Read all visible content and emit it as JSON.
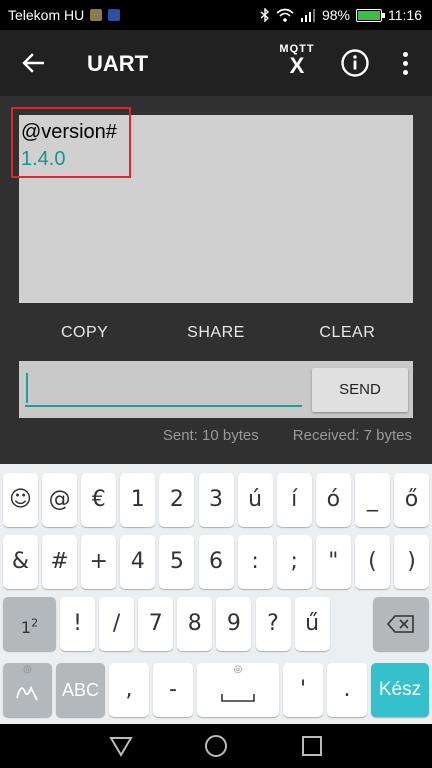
{
  "status_bar": {
    "carrier": "Telekom HU",
    "battery": "98%",
    "battery_level": 0.98,
    "time": "11:16",
    "icons": [
      "message-icon",
      "usb-icon",
      "bluetooth-icon",
      "wifi-icon",
      "signal-icon",
      "battery-charging-icon"
    ]
  },
  "app_bar": {
    "title": "UART",
    "mqtt_label": "MQTT",
    "mqtt_x": "X",
    "icons": [
      "back-arrow-icon",
      "mqtt-icon",
      "info-icon",
      "more-vert-icon"
    ]
  },
  "console": {
    "command": "@version#",
    "response": "1.4.0"
  },
  "actions": {
    "copy": "COPY",
    "share": "SHARE",
    "clear": "CLEAR"
  },
  "input": {
    "value": "",
    "send_label": "SEND"
  },
  "stats": {
    "sent": "Sent: 10 bytes",
    "received": "Received: 7 bytes"
  },
  "keyboard": {
    "row1": [
      "☺",
      "@",
      "€",
      "1",
      "2",
      "3",
      "ú",
      "í",
      "ó",
      "_",
      "ő"
    ],
    "row2": [
      "&",
      "#",
      "+",
      "4",
      "5",
      "6",
      ":",
      ";",
      "\"",
      "(",
      ")"
    ],
    "row3_keys": [
      "!",
      "/",
      "7",
      "8",
      "9",
      "?",
      "ű"
    ],
    "row3_page": "1",
    "row3_page_sup": "2",
    "row4_abc": "ABC",
    "row4_keys": [
      ",",
      "-",
      "'",
      "."
    ],
    "done_label": "Kész"
  },
  "nav": {
    "icons": [
      "back-triangle-icon",
      "home-circle-icon",
      "recents-square-icon"
    ]
  },
  "colors": {
    "accent": "#1e9f97",
    "highlight": "#e0252b",
    "done_key": "#34c1cc"
  }
}
